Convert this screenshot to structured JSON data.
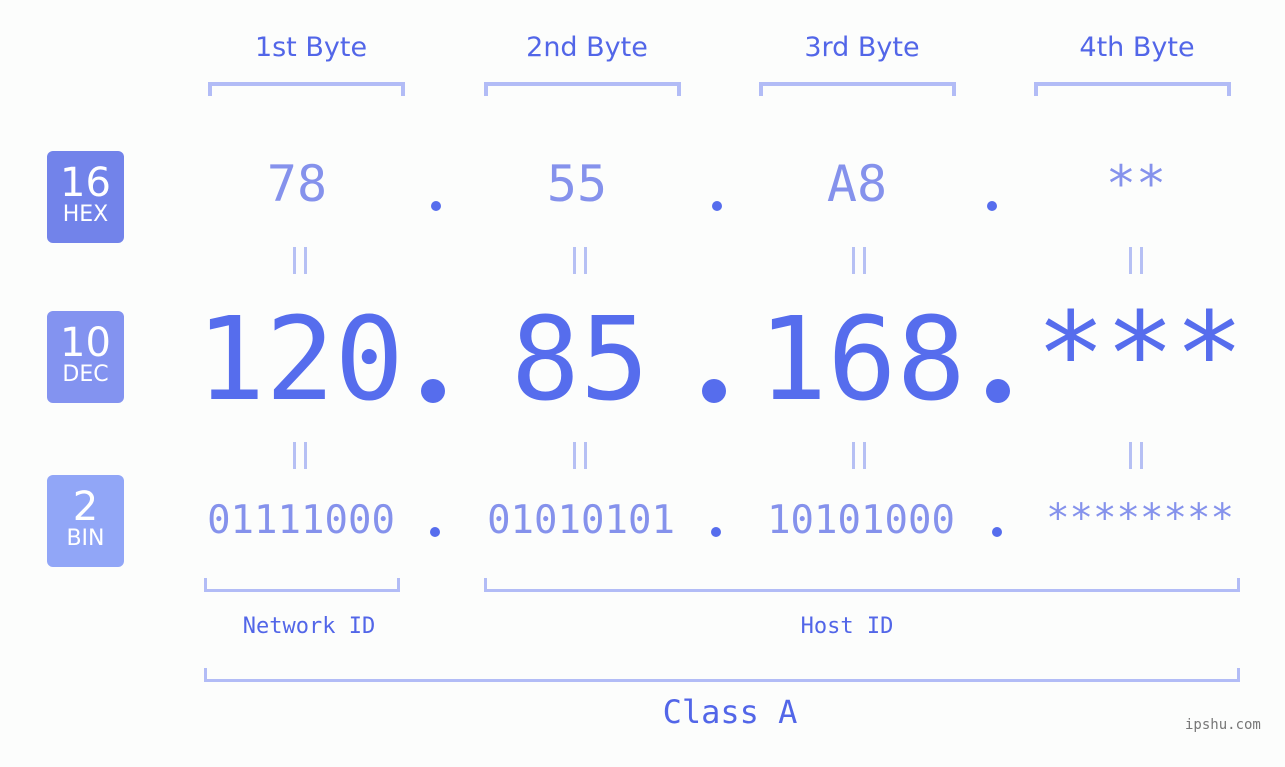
{
  "headers": [
    "1st Byte",
    "2nd Byte",
    "3rd Byte",
    "4th Byte"
  ],
  "badges": [
    {
      "base": "16",
      "label": "HEX",
      "color": "#7283ea"
    },
    {
      "base": "10",
      "label": "DEC",
      "color": "#8393f0"
    },
    {
      "base": "2",
      "label": "BIN",
      "color": "#91a6f7"
    }
  ],
  "hex": [
    "78",
    "55",
    "A8",
    "**"
  ],
  "dec": [
    "120",
    "85",
    "168",
    "***"
  ],
  "bin": [
    "01111000",
    "01010101",
    "10101000",
    "********"
  ],
  "labels": {
    "network_id": "Network ID",
    "host_id": "Host ID",
    "class": "Class A"
  },
  "watermark": "ipshu.com"
}
